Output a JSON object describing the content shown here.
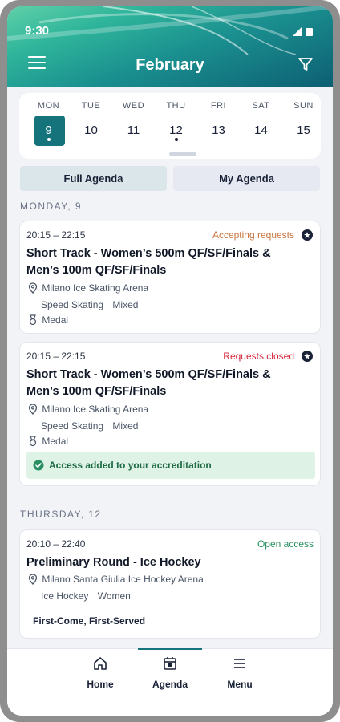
{
  "status_bar": {
    "time": "9:30"
  },
  "header": {
    "title": "February"
  },
  "week": [
    {
      "name": "MON",
      "num": "9",
      "selected": true,
      "has_events": true
    },
    {
      "name": "TUE",
      "num": "10",
      "selected": false,
      "has_events": false
    },
    {
      "name": "WED",
      "num": "11",
      "selected": false,
      "has_events": false
    },
    {
      "name": "THU",
      "num": "12",
      "selected": false,
      "has_events": true
    },
    {
      "name": "FRI",
      "num": "13",
      "selected": false,
      "has_events": false
    },
    {
      "name": "SAT",
      "num": "14",
      "selected": false,
      "has_events": false
    },
    {
      "name": "SUN",
      "num": "15",
      "selected": false,
      "has_events": false
    }
  ],
  "tabs": {
    "full": "Full Agenda",
    "mine": "My Agenda"
  },
  "sections": [
    {
      "label": "MONDAY, 9"
    },
    {
      "label": "THURSDAY, 12"
    }
  ],
  "events": [
    {
      "time": "20:15 – 22:15",
      "status": "Accepting requests",
      "title": "Short Track - Women’s 500m QF/SF/Finals & Men’s 100m QF/SF/Finals",
      "venue": "Milano Ice Skating Arena",
      "discipline": "Speed Skating",
      "gender": "Mixed",
      "medal": "Medal"
    },
    {
      "time": "20:15 – 22:15",
      "status": "Requests closed",
      "title": "Short Track - Women’s 500m QF/SF/Finals & Men’s 100m QF/SF/Finals",
      "venue": "Milano Ice Skating Arena",
      "discipline": "Speed Skating",
      "gender": "Mixed",
      "medal": "Medal",
      "banner": "Access added to your accreditation"
    },
    {
      "time": "20:10 – 22:40",
      "status": "Open access",
      "title": "Preliminary Round - Ice Hockey",
      "venue": "Milano Santa Giulia Ice Hockey Arena",
      "discipline": "Ice Hockey",
      "gender": "Women",
      "note": "First-Come, First-Served"
    }
  ],
  "bottom_nav": {
    "home": "Home",
    "agenda": "Agenda",
    "menu": "Menu"
  },
  "colors": {
    "brand": "#14737b",
    "accepting": "#c9723a",
    "closed": "#d7283c",
    "open": "#2a8f62"
  }
}
